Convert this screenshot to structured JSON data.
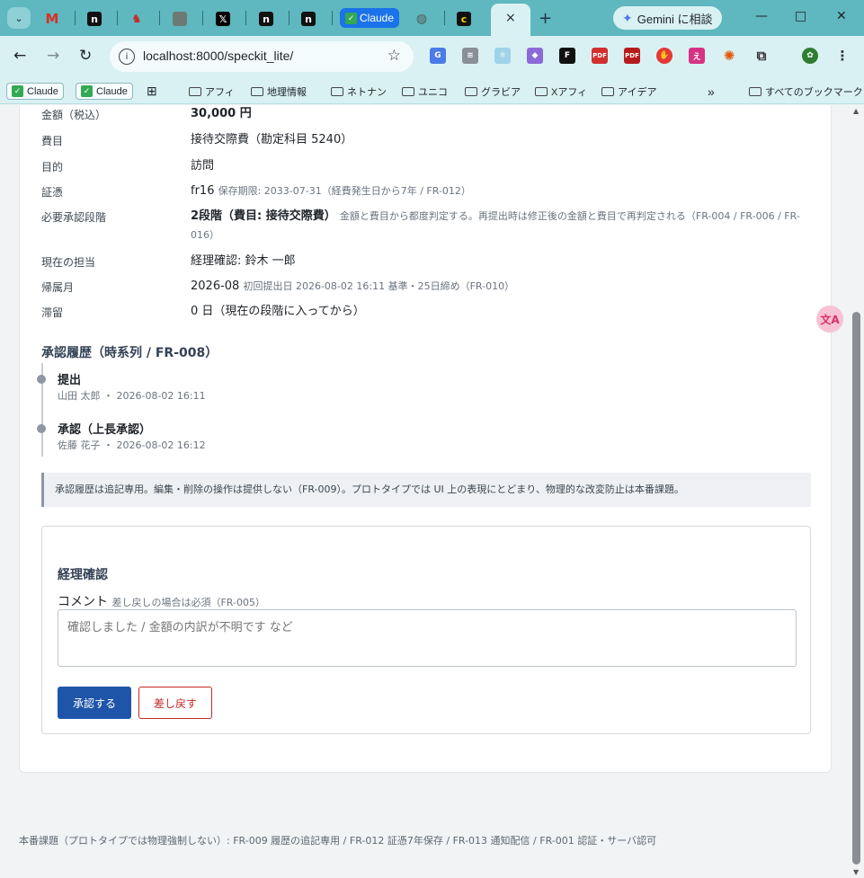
{
  "browser": {
    "tab_claude_label": "Claude",
    "active_tab_close": "×",
    "new_tab": "+",
    "gemini_label": "Gemini に相談",
    "window_controls": {
      "minimize": "—",
      "maximize": "□",
      "close": "✕"
    },
    "url": "localhost:8000/speckit_lite/",
    "bookmarks": [
      {
        "label": "Claude",
        "type": "chip"
      },
      {
        "label": "Claude",
        "type": "chip"
      },
      {
        "label": "アフィ",
        "type": "folder"
      },
      {
        "label": "地理情報",
        "type": "folder"
      },
      {
        "label": "ネトナン",
        "type": "folder"
      },
      {
        "label": "ユニコ",
        "type": "folder"
      },
      {
        "label": "グラビア",
        "type": "folder"
      },
      {
        "label": "Xアフィ",
        "type": "folder"
      },
      {
        "label": "アイデア",
        "type": "folder"
      }
    ],
    "bookmarks_overflow": "»",
    "all_bookmarks": "すべてのブックマーク"
  },
  "details": [
    {
      "label": "金額（税込）",
      "value": "30,000 円",
      "bold": true
    },
    {
      "label": "費目",
      "value": "接待交際費（勘定科目 5240）"
    },
    {
      "label": "目的",
      "value": "訪問"
    },
    {
      "label": "証憑",
      "value": "fr16",
      "note": "保存期限: 2033-07-31（経費発生日から7年 / FR-012）"
    },
    {
      "label": "必要承認段階",
      "value": "2段階（費目: 接待交際費）",
      "bold": true,
      "note": "金額と費目から都度判定する。再提出時は修正後の金額と費目で再判定される（FR-004 / FR-006 / FR-016）"
    },
    {
      "label": "現在の担当",
      "value": "経理確認: 鈴木 一郎"
    },
    {
      "label": "帰属月",
      "value": "2026-08",
      "note": "初回提出日 2026-08-02 16:11 基準・25日締め（FR-010）"
    },
    {
      "label": "滞留",
      "value": "0 日（現在の段階に入ってから）"
    }
  ],
  "history": {
    "title": "承認履歴（時系列 / FR-008）",
    "items": [
      {
        "action": "提出",
        "meta": "山田 太郎 ・ 2026-08-02 16:11"
      },
      {
        "action": "承認（上長承認）",
        "meta": "佐藤 花子 ・ 2026-08-02 16:12"
      }
    ],
    "note": "承認履歴は追記専用。編集・削除の操作は提供しない（FR-009）。プロトタイプでは UI 上の表現にとどまり、物理的な改変防止は本番課題。"
  },
  "action": {
    "title": "経理確認",
    "comment_label": "コメント",
    "comment_hint": "差し戻しの場合は必須（FR-005）",
    "comment_placeholder": "確認しました / 金額の内訳が不明です など",
    "approve_label": "承認する",
    "return_label": "差し戻す"
  },
  "footer": "本番課題（プロトタイプでは物理強制しない）: FR-009 履歴の追記専用 / FR-012 証憑7年保存 / FR-013 通知配信 / FR-001 認証・サーバ認可",
  "colors": {
    "primary": "#1f55a8",
    "danger": "#c62828",
    "chrome": "#5fb7bf"
  }
}
